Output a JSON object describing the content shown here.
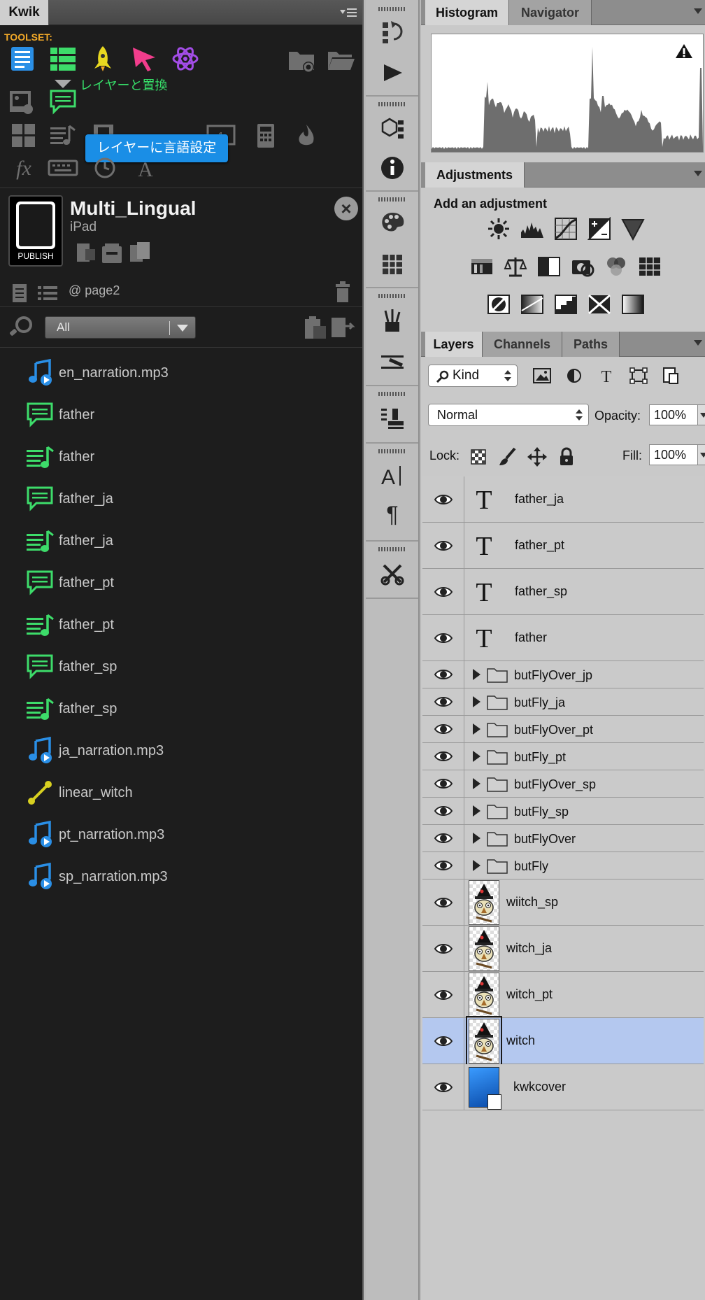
{
  "kwik": {
    "tab": "Kwik",
    "toolset_label": "TOOLSET:",
    "replace_layer_label": "レイヤーと置換",
    "tooltip": "レイヤーに言語設定",
    "project": {
      "name": "Multi_Lingual",
      "device": "iPad",
      "publish": "PUBLISH"
    },
    "page": "@ page2",
    "filter": "All",
    "layers": [
      {
        "type": "audio",
        "name": "en_narration.mp3"
      },
      {
        "type": "text",
        "name": "father"
      },
      {
        "type": "sync",
        "name": "father"
      },
      {
        "type": "text",
        "name": "father_ja"
      },
      {
        "type": "sync",
        "name": "father_ja"
      },
      {
        "type": "text",
        "name": "father_pt"
      },
      {
        "type": "sync",
        "name": "father_pt"
      },
      {
        "type": "text",
        "name": "father_sp"
      },
      {
        "type": "sync",
        "name": "father_sp"
      },
      {
        "type": "audio",
        "name": "ja_narration.mp3"
      },
      {
        "type": "linear",
        "name": "linear_witch"
      },
      {
        "type": "audio",
        "name": "pt_narration.mp3"
      },
      {
        "type": "audio",
        "name": "sp_narration.mp3"
      }
    ],
    "colors": {
      "audio": "#2a8fe6",
      "text": "#3ddc6a",
      "linear": "#d8d020",
      "accent": "#f2a928"
    }
  },
  "histogram": {
    "tab_active": "Histogram",
    "tab_other": "Navigator"
  },
  "adjustments": {
    "tab": "Adjustments",
    "title": "Add an adjustment"
  },
  "layers_panel": {
    "tabs": [
      "Layers",
      "Channels",
      "Paths"
    ],
    "kind": "Kind",
    "blend_mode": "Normal",
    "opacity_label": "Opacity:",
    "opacity": "100%",
    "lock_label": "Lock:",
    "fill_label": "Fill:",
    "fill": "100%",
    "layers": [
      {
        "kind": "text",
        "name": "father_ja"
      },
      {
        "kind": "text",
        "name": "father_pt"
      },
      {
        "kind": "text",
        "name": "father_sp"
      },
      {
        "kind": "text",
        "name": "father"
      },
      {
        "kind": "group",
        "name": "butFlyOver_jp"
      },
      {
        "kind": "group",
        "name": "butFly_ja"
      },
      {
        "kind": "group",
        "name": "butFlyOver_pt"
      },
      {
        "kind": "group",
        "name": "butFly_pt"
      },
      {
        "kind": "group",
        "name": "butFlyOver_sp"
      },
      {
        "kind": "group",
        "name": "butFly_sp"
      },
      {
        "kind": "group",
        "name": "butFlyOver"
      },
      {
        "kind": "group",
        "name": "butFly"
      },
      {
        "kind": "image",
        "name": "wiitch_sp"
      },
      {
        "kind": "image",
        "name": "witch_ja"
      },
      {
        "kind": "image",
        "name": "witch_pt"
      },
      {
        "kind": "image",
        "name": "witch",
        "selected": true
      },
      {
        "kind": "cover",
        "name": "kwkcover"
      }
    ],
    "selected_color": "#b4c8ef"
  }
}
